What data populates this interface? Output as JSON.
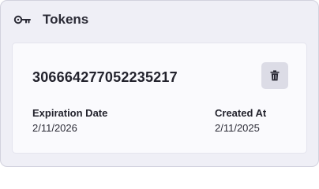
{
  "panel": {
    "title": "Tokens",
    "icon": "key-icon"
  },
  "token": {
    "value": "306664277052235217",
    "expiration_label": "Expiration Date",
    "expiration_value": "2/11/2026",
    "created_label": "Created At",
    "created_value": "2/11/2025",
    "delete_icon": "trash-icon"
  },
  "colors": {
    "panel_background": "#efeff6",
    "card_background": "#fafafd",
    "button_background": "#dcdce6",
    "text": "#2b2b36"
  }
}
